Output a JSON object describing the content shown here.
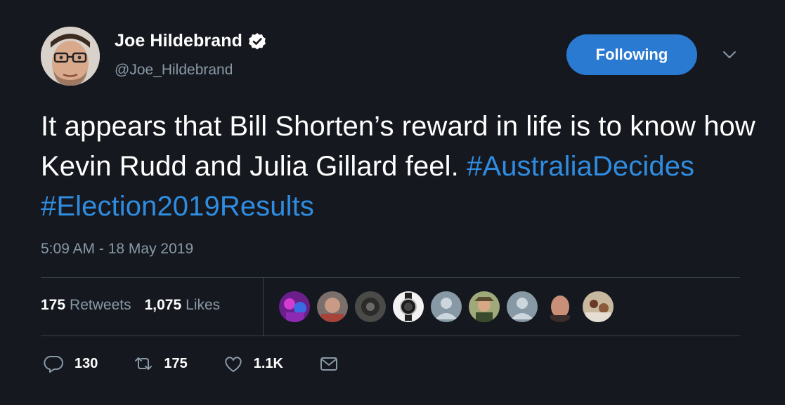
{
  "author": {
    "display_name": "Joe Hildebrand",
    "handle": "@Joe_Hildebrand",
    "verified": true
  },
  "follow_button": {
    "label": "Following",
    "color": "#2a7ad2"
  },
  "tweet": {
    "text_plain": "It appears that Bill Shorten’s reward in life is to know how Kevin Rudd and Julia Gillard feel.",
    "hashtags": [
      "#AustraliaDecides",
      "#Election2019Results"
    ],
    "timestamp": "5:09 AM - 18 May 2019"
  },
  "stats": {
    "retweets": {
      "count": "175",
      "label": "Retweets"
    },
    "likes": {
      "count": "1,075",
      "label": "Likes"
    }
  },
  "likers": [
    "liker-avatar-1",
    "liker-avatar-2",
    "liker-avatar-3",
    "liker-avatar-4",
    "liker-avatar-5",
    "liker-avatar-6",
    "liker-avatar-7",
    "liker-avatar-8",
    "liker-avatar-9"
  ],
  "actions": {
    "reply": {
      "icon": "reply-icon",
      "count": "130"
    },
    "retweet": {
      "icon": "retweet-icon",
      "count": "175"
    },
    "like": {
      "icon": "heart-icon",
      "count": "1.1K"
    },
    "message": {
      "icon": "envelope-icon"
    }
  },
  "colors": {
    "background": "#15181e",
    "text": "#ffffff",
    "secondary_text": "#8899a6",
    "hashtag": "#2f8ce0",
    "divider": "#38444d"
  }
}
